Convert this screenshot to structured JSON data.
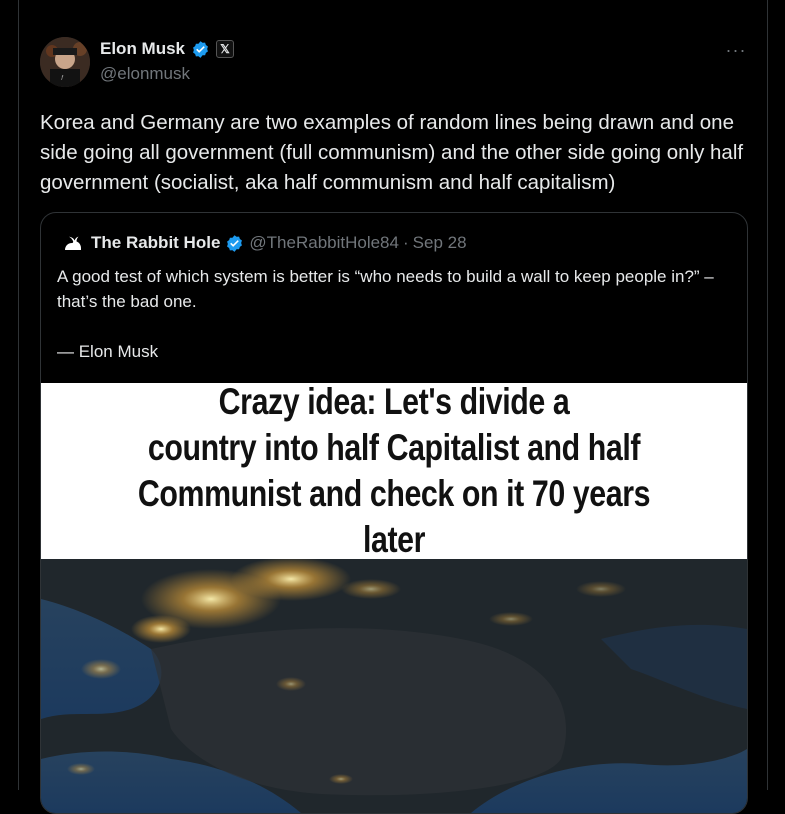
{
  "post": {
    "author_name": "Elon Musk",
    "author_handle": "@elonmusk",
    "verified_icon": "verified-badge-icon",
    "affiliation_icon": "x-logo-icon",
    "affiliation_text": "𝕏",
    "more_label": "···",
    "text": "Korea and Germany are two examples of random lines being drawn and one side going all government (full communism) and the other side going only half government (socialist, aka half communism and half capitalism)"
  },
  "quote": {
    "author_name": "The Rabbit Hole",
    "author_handle": "@TheRabbitHole84",
    "separator": "·",
    "date": "Sep 28",
    "text_line": "A good test of which system is better is “who needs to build a wall to keep people in?” – that’s the bad one.",
    "attribution": "— Elon Musk",
    "image": {
      "caption": "Crazy idea:  Let's divide a\ncountry into half Capitalist and half\nCommunist and check on it 70 years later"
    }
  },
  "colors": {
    "background": "#000000",
    "text_primary": "#e7e9ea",
    "text_secondary": "#71767b",
    "verified_blue": "#1d9bf0",
    "border": "#2f3336"
  }
}
